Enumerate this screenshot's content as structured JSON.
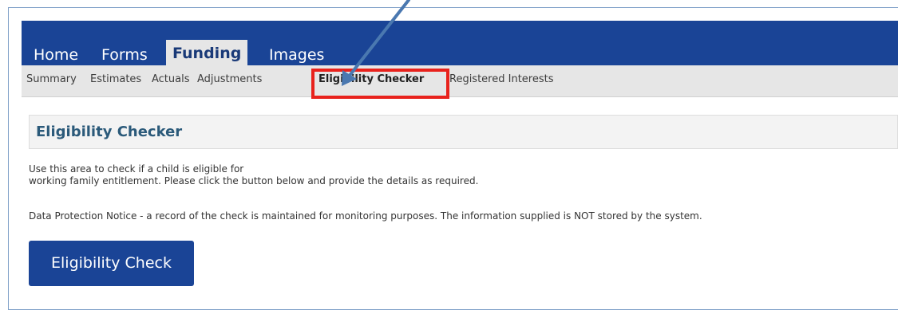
{
  "navbar": {
    "tabs": [
      {
        "label": "Home"
      },
      {
        "label": "Forms"
      },
      {
        "label": "Funding"
      },
      {
        "label": "Images"
      }
    ]
  },
  "subnav": {
    "items": [
      {
        "label": "Summary"
      },
      {
        "label": "Estimates"
      },
      {
        "label": "Actuals"
      },
      {
        "label": "Adjustments"
      },
      {
        "label": "Eligibility Checker"
      },
      {
        "label": "Registered Interests"
      }
    ]
  },
  "section": {
    "title": "Eligibility Checker"
  },
  "content": {
    "intro_line1": "Use this area to check if a child is eligible for",
    "intro_line2": "working family entitlement. Please click the button below and provide the details as required.",
    "notice": "Data Protection Notice - a record of the check is maintained for monitoring purposes. The information supplied is NOT stored by the system.",
    "button_label": "Eligibility Check"
  },
  "colors": {
    "navbar": "#1a4496",
    "highlight": "#e8221c",
    "arrow": "#4a78b0"
  }
}
